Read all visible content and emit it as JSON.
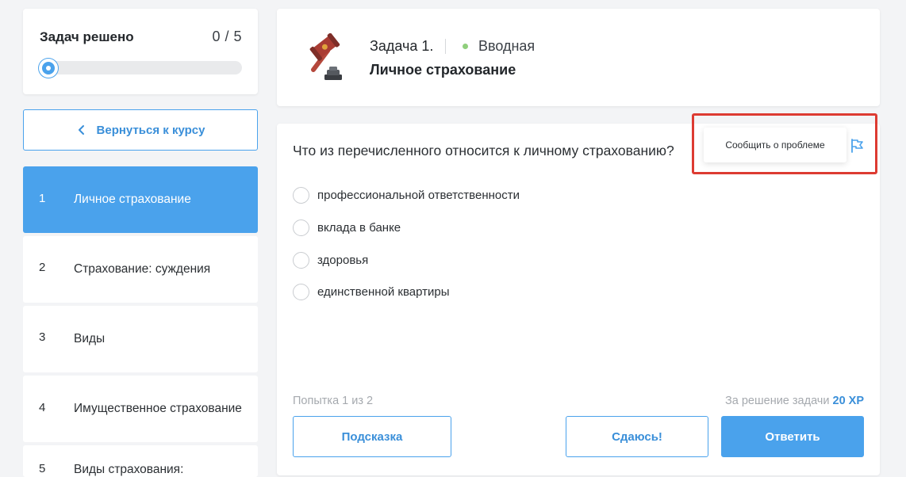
{
  "progress": {
    "title": "Задач решено",
    "count": "0 / 5",
    "fraction": 0.0
  },
  "back_button": {
    "label": "Вернуться к курсу",
    "icon": "chevron-left-icon"
  },
  "tasks": [
    {
      "num": "1",
      "label": "Личное страхование",
      "active": true
    },
    {
      "num": "2",
      "label": "Страхование: суждения",
      "active": false
    },
    {
      "num": "3",
      "label": "Виды",
      "active": false
    },
    {
      "num": "4",
      "label": "Имущественное страхование",
      "active": false
    },
    {
      "num": "5",
      "label": "Виды страхования:",
      "active": false
    }
  ],
  "header": {
    "task_number": "Задача 1.",
    "level": "Вводная",
    "task_title": "Личное страхование",
    "icon": "hammer-icon",
    "level_dot_color": "#8fcf7c"
  },
  "question": {
    "text": "Что из перечисленного относится к личному страхованию?",
    "options": [
      "профессиональной ответственности",
      "вклада в банке",
      "здоровья",
      "единственной квартиры"
    ],
    "report_tooltip": "Сообщить о проблеме",
    "report_icon": "flag-icon"
  },
  "footer": {
    "attempts": "Попытка 1 из 2",
    "reward_prefix": "За решение задачи",
    "reward_value": "20 XP",
    "hint_button": "Подсказка",
    "give_up_button": "Сдаюсь!",
    "answer_button": "Ответить"
  },
  "colors": {
    "accent": "#4aa2ec",
    "highlight": "#dd3b32",
    "background": "#f3f4f6"
  }
}
